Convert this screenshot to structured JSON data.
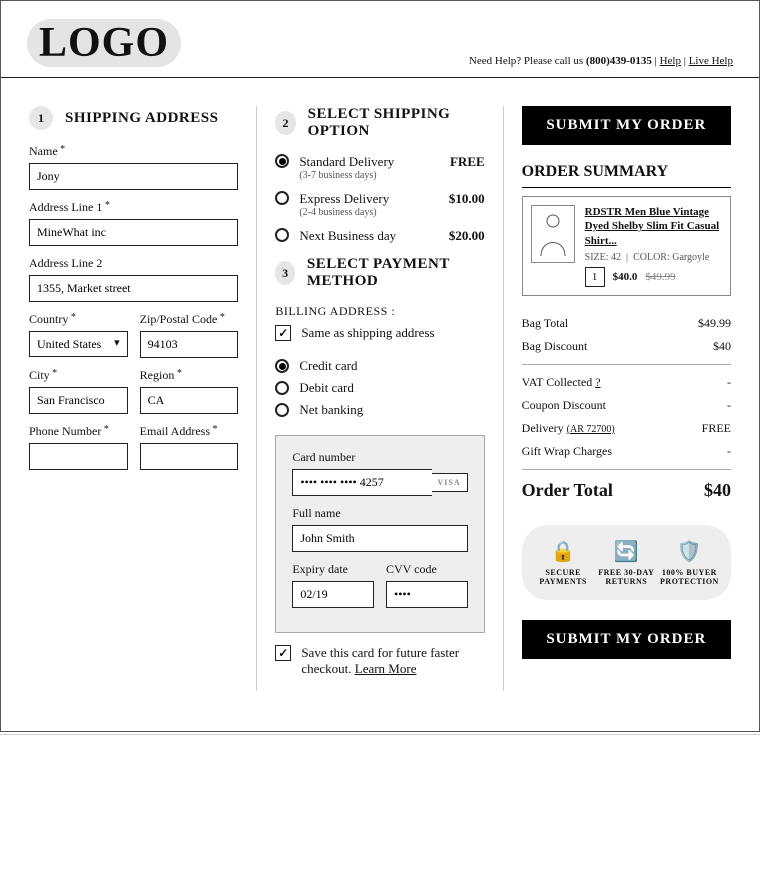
{
  "header": {
    "logo": "LOGO",
    "help_prefix": "Need Help? Please call us ",
    "phone": "(800)439-0135",
    "sep": " | ",
    "help_link": "Help",
    "live_help_link": "Live Help"
  },
  "sections": {
    "shipping_title": "SHIPPING ADDRESS",
    "shipping_step": "1",
    "shipopt_title": "SELECT SHIPPING OPTION",
    "shipopt_step": "2",
    "payment_title": "SELECT PAYMENT METHOD",
    "payment_step": "3",
    "summary_title": "ORDER SUMMARY"
  },
  "shipping": {
    "name_label": "Name",
    "name_value": "Jony",
    "addr1_label": "Address Line 1",
    "addr1_value": "MineWhat inc",
    "addr2_label": "Address Line 2",
    "addr2_value": "1355, Market street",
    "country_label": "Country",
    "country_value": "United States",
    "zip_label": "Zip/Postal Code",
    "zip_value": "94103",
    "city_label": "City",
    "city_value": "San Francisco",
    "region_label": "Region",
    "region_value": "CA",
    "phone_label": "Phone Number",
    "phone_value": "",
    "email_label": "Email Address",
    "email_value": ""
  },
  "ship_options": [
    {
      "label": "Standard Delivery",
      "sub": "(3-7 business days)",
      "price": "FREE",
      "checked": true
    },
    {
      "label": "Express Delivery",
      "sub": "(2-4 business days)",
      "price": "$10.00",
      "checked": false
    },
    {
      "label": "Next Business day",
      "sub": "",
      "price": "$20.00",
      "checked": false
    }
  ],
  "payment": {
    "billing_head": "BILLING ADDRESS :",
    "same_as_shipping": "Same as shipping address",
    "methods": {
      "credit": "Credit card",
      "debit": "Debit card",
      "netbank": "Net banking"
    },
    "card_number_label": "Card number",
    "card_number_value": "•••• •••• •••• 4257",
    "card_brand": "VISA",
    "full_name_label": "Full name",
    "full_name_value": "John Smith",
    "expiry_label": "Expiry date",
    "expiry_value": "02/19",
    "cvv_label": "CVV code",
    "cvv_value": "••••",
    "save_card_text": "Save this card for future faster checkout. ",
    "learn_more": "Learn More"
  },
  "submit_label": "SUBMIT MY ORDER",
  "order_item": {
    "title": "RDSTR Men Blue Vintage Dyed Shelby Slim Fit Casual Shirt...",
    "size_label": "SIZE:",
    "size": "42",
    "color_label": "COLOR:",
    "color": "Gargoyle",
    "qty": "1",
    "price": "$40.0",
    "price_orig": "$49.99"
  },
  "summary": {
    "bag_total_l": "Bag Total",
    "bag_total_v": "$49.99",
    "discount_l": "Bag Discount",
    "discount_v": "$40",
    "vat_l": "VAT Collected ",
    "vat_q": "?",
    "vat_v": "-",
    "coupon_l": "Coupon Discount",
    "coupon_v": "-",
    "delivery_l": "Delivery ",
    "delivery_code": "(AR 72700)",
    "delivery_v": "FREE",
    "gift_l": "Gift Wrap Charges",
    "gift_v": "-",
    "total_l": "Order Total",
    "total_v": "$40"
  },
  "badges": {
    "secure": "SECURE PAYMENTS",
    "returns": "FREE 30-DAY RETURNS",
    "buyer": "100% BUYER PROTECTION"
  }
}
